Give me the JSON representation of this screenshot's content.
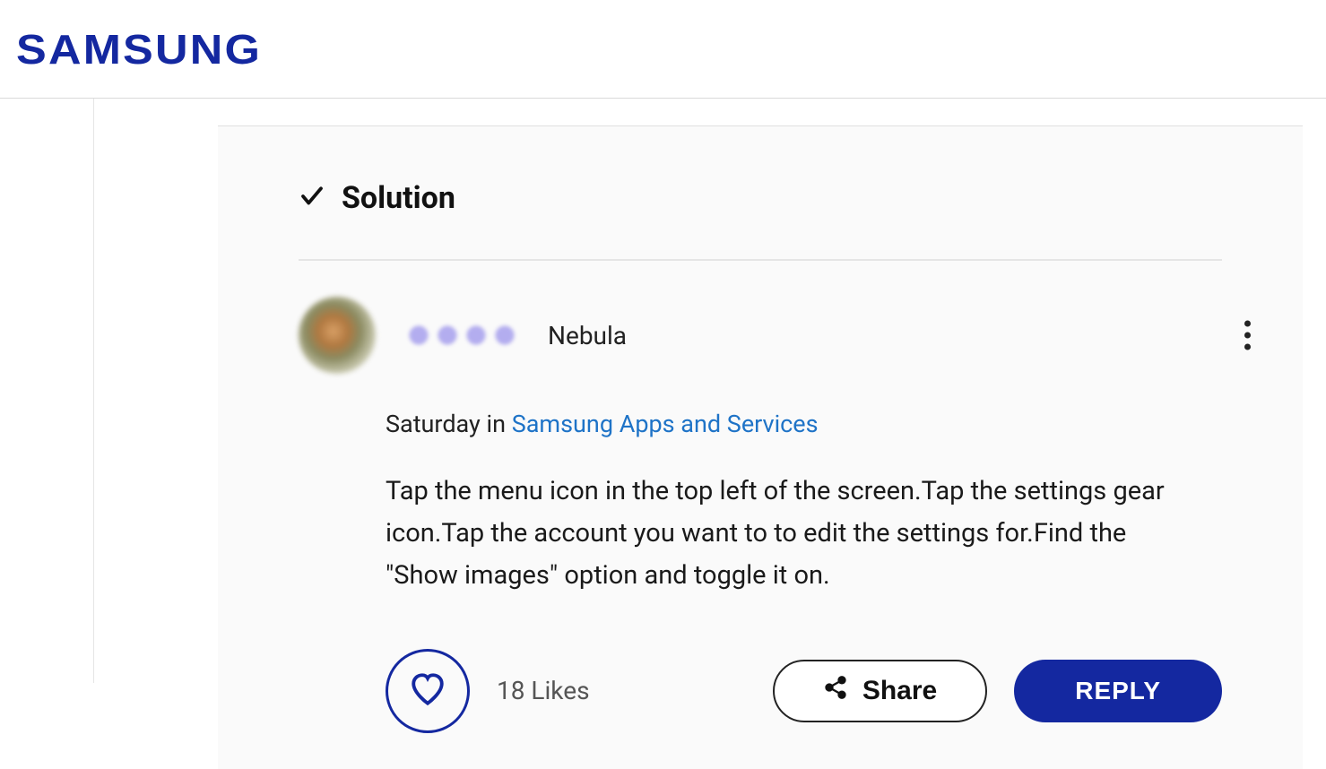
{
  "header": {
    "brand": "SAMSUNG"
  },
  "post": {
    "solution_label": "Solution",
    "user_rank": "Nebula",
    "posted_time": "Saturday",
    "in_word": "in",
    "category": "Samsung Apps and Services",
    "body": "Tap the menu icon in the top left of the screen.Tap the settings gear icon.Tap the account you want to to edit the settings for.Find the \"Show images\" option and toggle it on.",
    "likes_text": "18 Likes",
    "share_label": "Share",
    "reply_label": "REPLY"
  }
}
